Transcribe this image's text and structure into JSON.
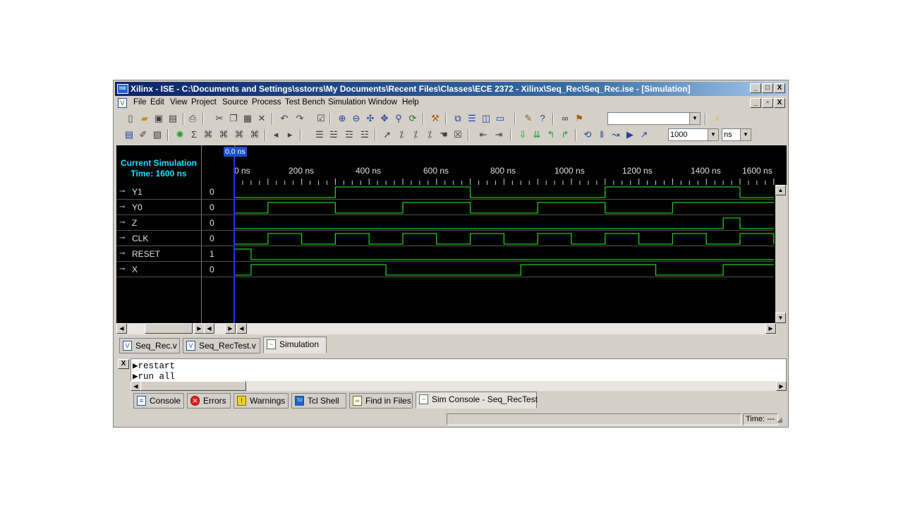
{
  "window": {
    "title": "Xilinx - ISE - C:\\Documents and Settings\\sstorrs\\My Documents\\Recent Files\\Classes\\ECE 2372 - Xilinx\\Seq_Rec\\Seq_Rec.ise - [Simulation]",
    "caption_buttons": [
      "_",
      "□",
      "X"
    ],
    "doc_buttons": [
      "_",
      "▫",
      "X"
    ]
  },
  "menu": [
    "File",
    "Edit",
    "View",
    "Project",
    "Source",
    "Process",
    "Test Bench",
    "Simulation",
    "Window",
    "Help"
  ],
  "toolbar2": {
    "sim_run_time": "1000",
    "time_unit": "ns"
  },
  "waveform": {
    "current_time_label": "Current Simulation\nTime: 1600 ns",
    "current_time_line1": "Current Simulation",
    "current_time_line2": "Time: 1600 ns",
    "cursor_label": "0.0 ns",
    "time_labels": [
      "0 ns",
      "200 ns",
      "400 ns",
      "600 ns",
      "800 ns",
      "1000 ns",
      "1200 ns",
      "1400 ns",
      "1600 ns"
    ],
    "wave_color": "#22c822",
    "signals": [
      {
        "name": "Y1",
        "value": "0"
      },
      {
        "name": "Y0",
        "value": "0"
      },
      {
        "name": "Z",
        "value": "0"
      },
      {
        "name": "CLK",
        "value": "0"
      },
      {
        "name": "RESET",
        "value": "1"
      },
      {
        "name": "X",
        "value": "0"
      }
    ]
  },
  "editor_tabs": [
    "Seq_Rec.v",
    "Seq_RecTest.v",
    "Simulation"
  ],
  "console": {
    "lines": [
      "restart",
      "run all"
    ]
  },
  "console_tabs": [
    "Console",
    "Errors",
    "Warnings",
    "Tcl Shell",
    "Find in Files",
    "Sim Console - Seq_RecTest"
  ],
  "status": {
    "time": "Time: ---"
  }
}
